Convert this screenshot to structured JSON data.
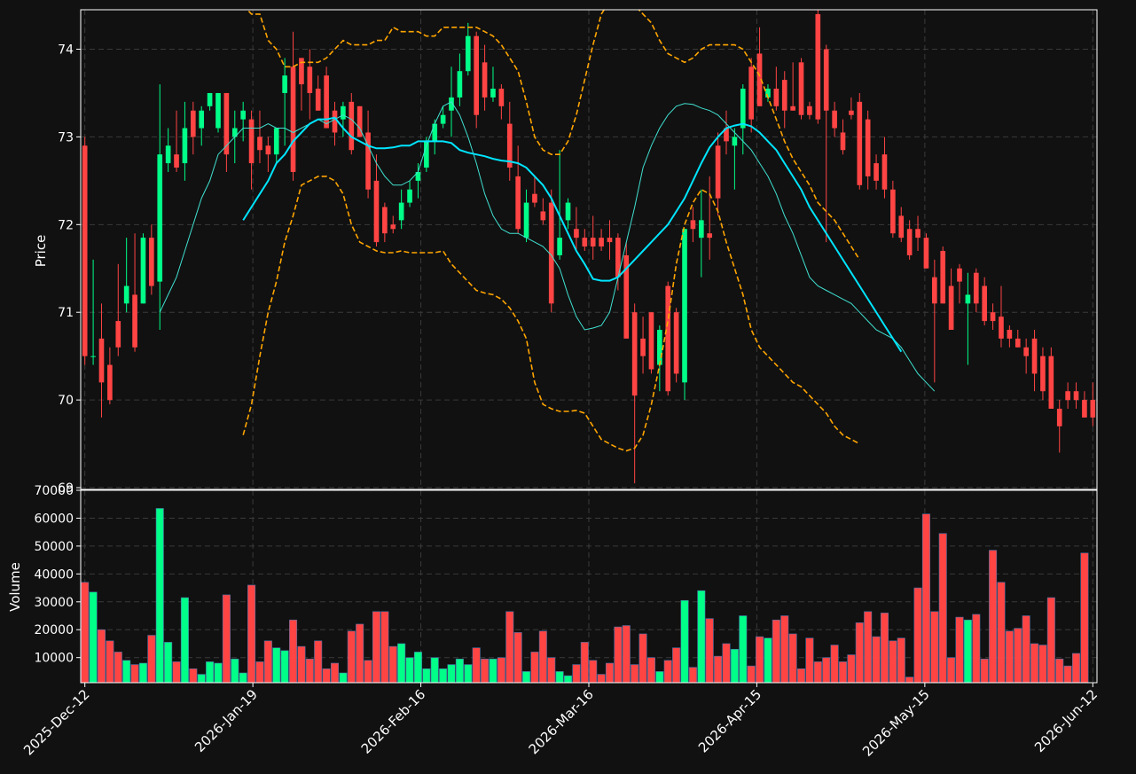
{
  "colors": {
    "background": "#111111",
    "up": "#00ff88",
    "down": "#ff4444",
    "ma_short": "#40e0d0",
    "ma_long": "#00e5ff",
    "bands": "#ffa500",
    "grid": "#3a3a3a",
    "axis": "#ffffff"
  },
  "chart_data": [
    {
      "type": "candlestick",
      "ylabel": "Price",
      "ylim": [
        68.98,
        74.45
      ],
      "yticks": [
        69,
        70,
        71,
        72,
        73,
        74
      ],
      "grid": true,
      "x_dates": [
        "2025-Dec-12",
        "2026-Jan-19",
        "2026-Feb-16",
        "2026-Mar-16",
        "2026-Apr-15",
        "2026-May-15",
        "2026-Jun-12"
      ],
      "candles": [
        [
          72.9,
          73.0,
          70.4,
          70.5
        ],
        [
          70.5,
          71.6,
          70.4,
          70.5
        ],
        [
          70.7,
          71.1,
          69.8,
          70.2
        ],
        [
          70.4,
          70.6,
          69.95,
          70.0
        ],
        [
          70.9,
          71.55,
          70.5,
          70.6
        ],
        [
          71.1,
          71.85,
          71.0,
          71.3
        ],
        [
          71.2,
          71.9,
          70.55,
          70.6
        ],
        [
          71.1,
          71.9,
          71.1,
          71.85
        ],
        [
          71.85,
          72.0,
          71.2,
          71.3
        ],
        [
          71.35,
          73.6,
          70.8,
          72.8
        ],
        [
          72.7,
          73.1,
          72.6,
          72.9
        ],
        [
          72.8,
          73.3,
          72.6,
          72.65
        ],
        [
          72.7,
          73.4,
          72.5,
          73.1
        ],
        [
          73.3,
          73.4,
          72.8,
          73.0
        ],
        [
          73.1,
          73.35,
          72.9,
          73.3
        ],
        [
          73.35,
          73.5,
          73.3,
          73.5
        ],
        [
          73.1,
          73.5,
          73.05,
          73.5
        ],
        [
          73.5,
          73.5,
          72.6,
          72.8
        ],
        [
          73.0,
          73.3,
          72.7,
          73.1
        ],
        [
          73.2,
          73.4,
          72.95,
          73.3
        ],
        [
          73.2,
          73.3,
          72.4,
          72.7
        ],
        [
          73.0,
          73.3,
          72.7,
          72.85
        ],
        [
          72.9,
          73.0,
          72.6,
          72.8
        ],
        [
          72.8,
          73.1,
          72.7,
          73.1
        ],
        [
          73.5,
          73.9,
          72.9,
          73.7
        ],
        [
          73.8,
          74.2,
          72.5,
          72.6
        ],
        [
          73.9,
          73.9,
          73.3,
          73.6
        ],
        [
          73.8,
          74.0,
          73.2,
          73.5
        ],
        [
          73.55,
          73.7,
          73.3,
          73.3
        ],
        [
          73.7,
          73.8,
          73.1,
          73.1
        ],
        [
          73.3,
          73.4,
          72.9,
          73.05
        ],
        [
          73.2,
          73.4,
          73.0,
          73.35
        ],
        [
          73.4,
          73.5,
          72.8,
          72.85
        ],
        [
          73.35,
          73.35,
          73.0,
          73.0
        ],
        [
          73.05,
          73.3,
          72.3,
          72.4
        ],
        [
          72.5,
          72.8,
          71.75,
          71.8
        ],
        [
          72.2,
          72.25,
          71.8,
          71.9
        ],
        [
          72.0,
          72.1,
          71.9,
          71.95
        ],
        [
          72.05,
          72.4,
          71.95,
          72.25
        ],
        [
          72.25,
          72.5,
          72.2,
          72.4
        ],
        [
          72.5,
          72.7,
          72.3,
          72.6
        ],
        [
          72.65,
          73.0,
          72.6,
          72.95
        ],
        [
          72.95,
          73.2,
          72.8,
          73.15
        ],
        [
          73.15,
          73.35,
          73.1,
          73.25
        ],
        [
          73.3,
          73.8,
          73.0,
          73.45
        ],
        [
          73.45,
          73.95,
          73.35,
          73.75
        ],
        [
          73.75,
          74.3,
          73.7,
          74.15
        ],
        [
          74.15,
          74.2,
          73.1,
          73.25
        ],
        [
          73.85,
          74.05,
          73.3,
          73.45
        ],
        [
          73.45,
          73.8,
          73.4,
          73.55
        ],
        [
          73.55,
          73.6,
          73.2,
          73.35
        ],
        [
          73.15,
          73.4,
          72.5,
          72.65
        ],
        [
          72.55,
          72.9,
          71.9,
          71.95
        ],
        [
          71.85,
          72.4,
          71.8,
          72.25
        ],
        [
          72.35,
          72.55,
          72.2,
          72.25
        ],
        [
          72.15,
          72.3,
          72.0,
          72.05
        ],
        [
          72.25,
          72.4,
          71.0,
          71.1
        ],
        [
          71.65,
          72.85,
          71.6,
          71.85
        ],
        [
          72.05,
          72.3,
          71.95,
          72.25
        ],
        [
          71.95,
          72.2,
          71.7,
          71.85
        ],
        [
          71.85,
          71.95,
          71.7,
          71.75
        ],
        [
          71.85,
          72.1,
          71.6,
          71.75
        ],
        [
          71.85,
          71.95,
          71.7,
          71.75
        ],
        [
          71.85,
          72.05,
          71.6,
          71.8
        ],
        [
          71.85,
          71.9,
          71.25,
          71.4
        ],
        [
          71.65,
          71.8,
          70.8,
          70.7
        ],
        [
          71.0,
          71.1,
          69.05,
          70.05
        ],
        [
          70.7,
          70.95,
          70.3,
          70.5
        ],
        [
          71.0,
          71.0,
          70.3,
          70.35
        ],
        [
          70.4,
          70.85,
          70.1,
          70.8
        ],
        [
          71.3,
          71.35,
          70.05,
          70.1
        ],
        [
          71.0,
          71.05,
          70.2,
          70.3
        ],
        [
          70.2,
          71.95,
          70.0,
          71.95
        ],
        [
          72.05,
          72.2,
          71.8,
          71.95
        ],
        [
          71.85,
          72.4,
          71.4,
          72.05
        ],
        [
          71.9,
          72.55,
          71.6,
          71.85
        ],
        [
          72.9,
          73.05,
          72.1,
          72.3
        ],
        [
          73.1,
          73.3,
          72.8,
          72.95
        ],
        [
          72.9,
          73.1,
          72.4,
          73.0
        ],
        [
          73.1,
          73.6,
          72.8,
          73.55
        ],
        [
          73.8,
          73.9,
          73.05,
          73.2
        ],
        [
          73.95,
          74.25,
          73.6,
          73.35
        ],
        [
          73.45,
          73.6,
          73.4,
          73.55
        ],
        [
          73.55,
          73.8,
          73.3,
          73.35
        ],
        [
          73.65,
          73.75,
          73.1,
          73.3
        ],
        [
          73.35,
          73.85,
          73.3,
          73.3
        ],
        [
          73.85,
          73.9,
          73.2,
          73.25
        ],
        [
          73.35,
          73.4,
          73.2,
          73.25
        ],
        [
          74.4,
          74.45,
          73.15,
          73.2
        ],
        [
          74.0,
          74.05,
          71.8,
          73.3
        ],
        [
          73.3,
          73.4,
          73.0,
          73.1
        ],
        [
          73.05,
          73.2,
          72.8,
          72.85
        ],
        [
          73.3,
          73.45,
          73.2,
          73.25
        ],
        [
          73.4,
          73.5,
          72.4,
          72.45
        ],
        [
          73.2,
          73.3,
          72.4,
          72.55
        ],
        [
          72.7,
          72.8,
          72.4,
          72.5
        ],
        [
          72.8,
          73.0,
          72.3,
          72.4
        ],
        [
          72.4,
          72.5,
          71.85,
          71.9
        ],
        [
          72.1,
          72.2,
          71.8,
          71.85
        ],
        [
          71.95,
          72.05,
          71.6,
          71.65
        ],
        [
          71.95,
          72.1,
          71.7,
          71.85
        ],
        [
          71.85,
          71.9,
          71.5,
          71.5
        ],
        [
          71.4,
          71.6,
          70.2,
          71.1
        ],
        [
          71.7,
          71.75,
          71.1,
          71.1
        ],
        [
          71.3,
          71.5,
          70.8,
          70.8
        ],
        [
          71.5,
          71.55,
          71.1,
          71.35
        ],
        [
          71.1,
          71.45,
          70.4,
          71.2
        ],
        [
          71.45,
          71.5,
          71.0,
          71.1
        ],
        [
          71.3,
          71.4,
          70.85,
          70.9
        ],
        [
          71.0,
          71.1,
          70.8,
          70.9
        ],
        [
          70.95,
          71.3,
          70.6,
          70.7
        ],
        [
          70.8,
          70.85,
          70.6,
          70.7
        ],
        [
          70.7,
          70.8,
          70.6,
          70.6
        ],
        [
          70.6,
          70.7,
          70.3,
          70.5
        ],
        [
          70.7,
          70.8,
          70.1,
          70.3
        ],
        [
          70.5,
          70.6,
          70.0,
          70.1
        ],
        [
          70.5,
          70.6,
          69.9,
          69.9
        ],
        [
          69.9,
          70.0,
          69.4,
          69.7
        ],
        [
          70.1,
          70.2,
          69.9,
          70.0
        ],
        [
          70.1,
          70.2,
          69.9,
          70.0
        ],
        [
          70.0,
          70.1,
          69.8,
          69.8
        ],
        [
          70.0,
          70.2,
          69.7,
          69.8
        ]
      ],
      "ma_short": {
        "start_index": 9,
        "values": [
          71.0,
          71.2,
          71.4,
          71.7,
          72.0,
          72.3,
          72.5,
          72.8,
          72.9,
          73.0,
          73.1,
          73.1,
          73.1,
          73.15,
          73.1,
          73.1,
          73.05,
          73.1,
          73.15,
          73.2,
          73.15,
          73.2,
          73.25,
          73.2,
          73.1,
          72.9,
          72.7,
          72.55,
          72.45,
          72.45,
          72.5,
          72.6,
          72.9,
          73.15,
          73.35,
          73.4,
          73.25,
          73.0,
          72.7,
          72.35,
          72.1,
          71.95,
          71.9,
          71.9,
          71.85,
          71.8,
          71.75,
          71.65,
          71.5,
          71.2,
          70.95,
          70.8,
          70.82,
          70.85,
          71.0,
          71.4,
          71.8,
          72.2,
          72.65,
          72.9,
          73.1,
          73.25,
          73.35,
          73.38,
          73.37,
          73.33,
          73.3,
          73.25,
          73.15,
          73.05,
          72.95,
          72.85,
          72.7,
          72.55,
          72.35,
          72.1,
          71.9,
          71.65,
          71.4,
          71.3,
          71.25,
          71.2,
          71.15,
          71.1,
          71.0,
          70.9,
          70.8,
          70.75,
          70.7,
          70.6,
          70.45,
          70.3,
          70.2,
          70.1
        ]
      },
      "ma_long": {
        "start_index": 19,
        "values": [
          72.05,
          72.2,
          72.35,
          72.5,
          72.7,
          72.8,
          72.95,
          73.05,
          73.15,
          73.2,
          73.2,
          73.22,
          73.1,
          73.0,
          72.95,
          72.9,
          72.87,
          72.87,
          72.88,
          72.9,
          72.9,
          72.95,
          72.95,
          72.95,
          72.95,
          72.93,
          72.85,
          72.82,
          72.8,
          72.78,
          72.75,
          72.73,
          72.72,
          72.7,
          72.65,
          72.55,
          72.45,
          72.3,
          72.1,
          71.9,
          71.7,
          71.55,
          71.38,
          71.36,
          71.36,
          71.4,
          71.5,
          71.6,
          71.7,
          71.8,
          71.9,
          72.0,
          72.15,
          72.3,
          72.5,
          72.7,
          72.88,
          73.0,
          73.1,
          73.13,
          73.15,
          73.12,
          73.05,
          72.95,
          72.85,
          72.7,
          72.55,
          72.4,
          72.2,
          72.05,
          71.9,
          71.75,
          71.6,
          71.45,
          71.3,
          71.15,
          71.0,
          70.85,
          70.7,
          70.55
        ]
      },
      "upper_band": {
        "start_index": 19,
        "values": [
          74.5,
          74.4,
          74.4,
          74.1,
          74.0,
          73.8,
          73.8,
          73.85,
          73.85,
          73.85,
          73.9,
          74.0,
          74.1,
          74.05,
          74.05,
          74.05,
          74.1,
          74.1,
          74.25,
          74.2,
          74.2,
          74.2,
          74.15,
          74.15,
          74.25,
          74.25,
          74.25,
          74.25,
          74.25,
          74.2,
          74.15,
          74.05,
          73.9,
          73.75,
          73.4,
          73.0,
          72.85,
          72.8,
          72.8,
          72.95,
          73.25,
          73.65,
          74.05,
          74.4,
          74.55,
          74.6,
          74.6,
          74.5,
          74.4,
          74.3,
          74.1,
          73.95,
          73.9,
          73.85,
          73.9,
          74.0,
          74.05,
          74.05,
          74.05,
          74.05,
          74.0,
          73.85,
          73.7,
          73.45,
          73.2,
          72.95,
          72.75,
          72.6,
          72.45,
          72.25,
          72.15,
          72.05,
          71.9,
          71.75,
          71.6
        ]
      },
      "lower_band": {
        "start_index": 19,
        "values": [
          69.6,
          69.95,
          70.5,
          71.0,
          71.35,
          71.8,
          72.1,
          72.45,
          72.5,
          72.55,
          72.55,
          72.5,
          72.35,
          72.0,
          71.8,
          71.75,
          71.7,
          71.68,
          71.68,
          71.7,
          71.68,
          71.68,
          71.68,
          71.68,
          71.7,
          71.55,
          71.45,
          71.35,
          71.25,
          71.22,
          71.2,
          71.15,
          71.05,
          70.9,
          70.7,
          70.2,
          69.95,
          69.9,
          69.87,
          69.87,
          69.88,
          69.85,
          69.7,
          69.55,
          69.5,
          69.45,
          69.42,
          69.45,
          69.6,
          69.95,
          70.4,
          70.9,
          71.55,
          72.0,
          72.25,
          72.4,
          72.35,
          72.15,
          71.8,
          71.5,
          71.2,
          70.8,
          70.6,
          70.5,
          70.4,
          70.3,
          70.2,
          70.15,
          70.05,
          69.95,
          69.85,
          69.7,
          69.6,
          69.55,
          69.5
        ]
      }
    },
    {
      "type": "bar",
      "ylabel": "Volume",
      "ylim": [
        1000,
        70000
      ],
      "yticks": [
        10000,
        20000,
        30000,
        40000,
        50000,
        60000,
        70000
      ],
      "grid": true,
      "values": [
        37000,
        33500,
        20000,
        16000,
        12000,
        9000,
        7500,
        8000,
        18000,
        63500,
        15500,
        8500,
        31500,
        6000,
        4000,
        8500,
        8000,
        32500,
        9500,
        4500,
        36000,
        8500,
        16000,
        13500,
        12500,
        23500,
        14000,
        9500,
        16000,
        6000,
        8000,
        4500,
        19500,
        22000,
        9000,
        26500,
        26500,
        14000,
        15000,
        10000,
        12000,
        6000,
        10000,
        6000,
        7500,
        9500,
        7500,
        13500,
        9500,
        9500,
        10000,
        26500,
        19000,
        5000,
        12000,
        19500,
        10000,
        5000,
        3500,
        7500,
        15500,
        9000,
        4000,
        8000,
        21000,
        21500,
        7500,
        18500,
        10000,
        5000,
        9000,
        13500,
        30500,
        6500,
        34000,
        24000,
        10500,
        15000,
        13000,
        25000,
        7000,
        17500,
        17000,
        23500,
        25000,
        18500,
        6000,
        17000,
        8500,
        10000,
        14500,
        8500,
        11000,
        22500,
        26500,
        17500,
        26000,
        16000,
        17000,
        3000,
        35000,
        61500,
        26500,
        54500,
        10000,
        24500,
        23500,
        25500,
        9500,
        48500,
        37000,
        19500,
        20500,
        25000,
        15000,
        14500,
        31500,
        9500,
        7000,
        11500,
        47500
      ]
    }
  ]
}
